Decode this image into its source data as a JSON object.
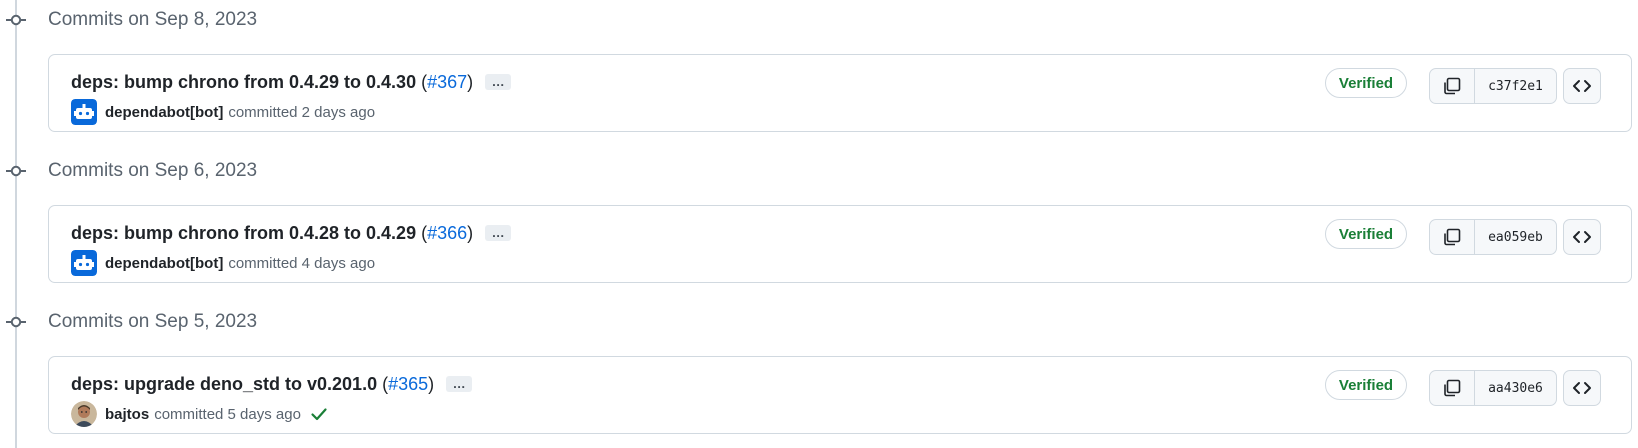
{
  "groups": [
    {
      "date_label": "Commits on Sep 8, 2023",
      "commit": {
        "message": "deps: bump chrono from 0.4.29 to 0.4.30",
        "pr": "#367",
        "author": "dependabot[bot]",
        "committed_text": "committed 2 days ago",
        "verified": "Verified",
        "sha": "c37f2e1",
        "avatar": "dependabot-icon",
        "status_check": false
      }
    },
    {
      "date_label": "Commits on Sep 6, 2023",
      "commit": {
        "message": "deps: bump chrono from 0.4.28 to 0.4.29",
        "pr": "#366",
        "author": "dependabot[bot]",
        "committed_text": "committed 4 days ago",
        "verified": "Verified",
        "sha": "ea059eb",
        "avatar": "dependabot-icon",
        "status_check": false
      }
    },
    {
      "date_label": "Commits on Sep 5, 2023",
      "commit": {
        "message": "deps: upgrade deno_std to v0.201.0",
        "pr": "#365",
        "author": "bajtos",
        "committed_text": "committed 5 days ago",
        "verified": "Verified",
        "sha": "aa430e6",
        "avatar": "user-avatar-photo",
        "status_check": true
      }
    }
  ],
  "ellipsis_label": "…",
  "paren_open": "(",
  "paren_close": ")",
  "colors": {
    "accent_link": "#0969da",
    "verified_green": "#1a7f37",
    "dependabot_blue": "#0969da",
    "border": "#d1d9e0"
  }
}
